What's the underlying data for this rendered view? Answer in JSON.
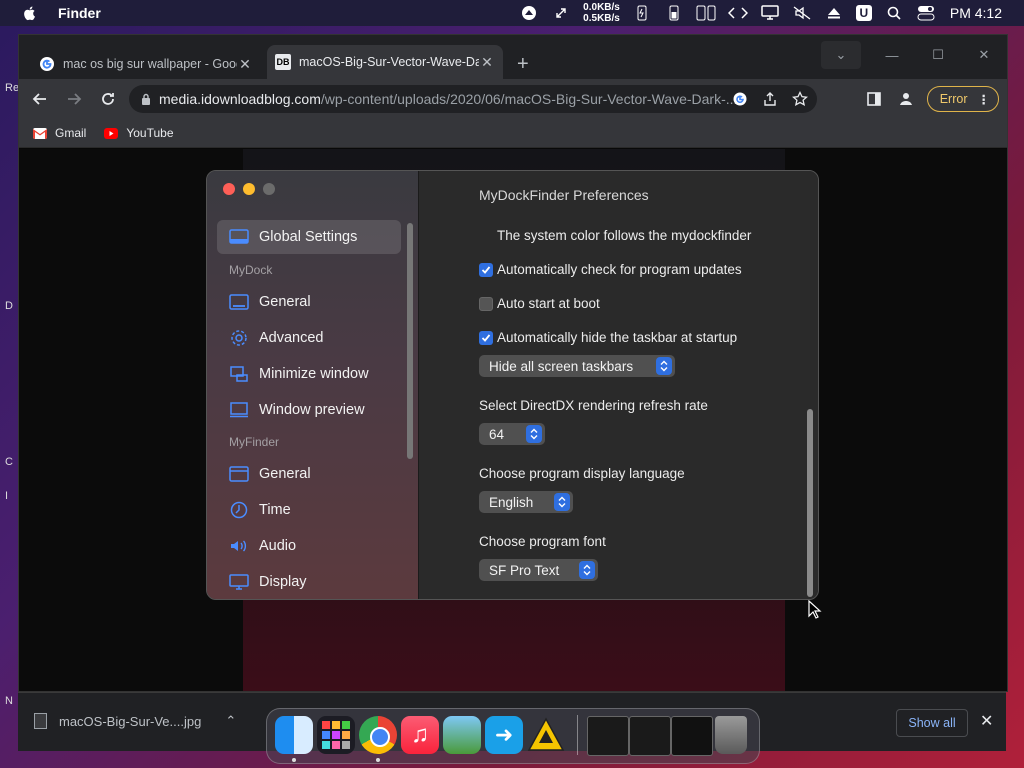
{
  "menubar": {
    "app_name": "Finder",
    "net_up": "0.0KB/s",
    "net_down": "0.5KB/s",
    "user_badge": "U",
    "clock": "PM 4:12"
  },
  "desktop": {
    "edge_labels": [
      "Re",
      "D",
      "C",
      "I",
      "N"
    ]
  },
  "browser": {
    "tabs": [
      {
        "title": "mac os big sur wallpaper - Goog",
        "favicon": "google-icon"
      },
      {
        "title": "macOS-Big-Sur-Vector-Wave-Da",
        "favicon": "idb-icon",
        "favicon_text": "DB"
      }
    ],
    "address": {
      "host": "media.idownloadblog.com",
      "path": "/wp-content/uploads/2020/06/macOS-Big-Sur-Vector-Wave-Dark-..."
    },
    "error_label": "Error",
    "bookmarks": [
      {
        "label": "Gmail",
        "color": "#ea4335"
      },
      {
        "label": "YouTube",
        "color": "#ff0000"
      }
    ]
  },
  "downloads": {
    "file_name": "macOS-Big-Sur-Ve....jpg",
    "show_all": "Show all"
  },
  "prefs": {
    "title": "MyDockFinder Preferences",
    "sidebar": {
      "selected": "Global Settings",
      "group_mydock": "MyDock",
      "group_myfinder": "MyFinder",
      "items_mydock": [
        "General",
        "Advanced",
        "Minimize window",
        "Window preview"
      ],
      "items_myfinder": [
        "General",
        "Time",
        "Audio",
        "Display"
      ]
    },
    "options": {
      "system_color": "The system color follows the mydockfinder",
      "check_updates": "Automatically check for program updates",
      "auto_start": "Auto start at boot",
      "hide_taskbar": "Automatically hide the taskbar at startup"
    },
    "taskbar_select": "Hide all screen taskbars",
    "refresh_label": "Select DirectDX rendering refresh rate",
    "refresh_value": "64",
    "language_label": "Choose program display language",
    "language_value": "English",
    "font_label": "Choose program font",
    "font_value": "SF Pro Text",
    "accent_color": "#2f6fe0"
  }
}
